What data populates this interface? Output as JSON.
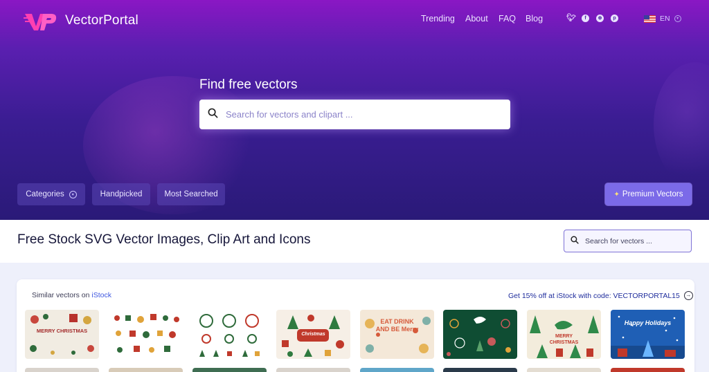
{
  "brand": {
    "name": "VectorPortal",
    "logo_letters": "VP"
  },
  "nav": {
    "items": [
      "Trending",
      "About",
      "FAQ",
      "Blog"
    ]
  },
  "social": [
    "twitter-icon",
    "facebook-icon",
    "dribbble-icon",
    "pinterest-icon"
  ],
  "lang": {
    "code": "EN"
  },
  "hero": {
    "title": "Find free vectors",
    "search_placeholder": "Search for vectors and clipart ..."
  },
  "filters": {
    "categories": "Categories",
    "handpicked": "Handpicked",
    "most_searched": "Most Searched",
    "premium": "Premium Vectors"
  },
  "page": {
    "title": "Free Stock SVG Vector Images, Clip Art and Icons",
    "search_placeholder": "Search for vectors ..."
  },
  "istock": {
    "prefix": "Similar vectors on ",
    "link": "iStock",
    "promo": "Get 15% off at iStock with code: VECTORPORTAL15"
  },
  "thumbnails": [
    {
      "bg": "#f1ece2",
      "text": "MERRY CHRISTMAS",
      "text_color": "#a32c2c"
    },
    {
      "bg": "#ffffff",
      "text": "",
      "text_color": "#c0392b"
    },
    {
      "bg": "#ffffff",
      "text": "",
      "text_color": "#2f6b3b"
    },
    {
      "bg": "#f6efe6",
      "text": "Christmas",
      "text_color": "#ffffff"
    },
    {
      "bg": "#f4e8d8",
      "text": "EAT DRINK AND BE Merry",
      "text_color": "#d65a3a"
    },
    {
      "bg": "#0f4d33",
      "text": "",
      "text_color": "#ffffff"
    },
    {
      "bg": "#f3ecdc",
      "text": "MERRY CHRISTMAS",
      "text_color": "#c0392b"
    },
    {
      "bg": "#1f5fb5",
      "text": "Happy Holidays",
      "text_color": "#ffffff"
    }
  ],
  "colors": {
    "hero_top": "#8a17c4",
    "hero_bottom": "#2a1a78",
    "accent": "#7b6ae8",
    "link": "#3f57e0"
  }
}
